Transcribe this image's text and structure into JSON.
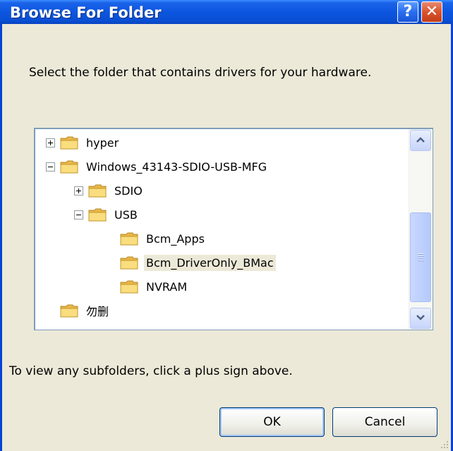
{
  "window": {
    "title": "Browse For Folder",
    "help_glyph": "?",
    "close_glyph": "✕"
  },
  "instructions": "Select the folder that contains drivers for your hardware.",
  "tree": {
    "items": [
      {
        "label": "hyper",
        "expander": "plus",
        "selected": false
      },
      {
        "label": "Windows_43143-SDIO-USB-MFG",
        "expander": "minus",
        "selected": false
      },
      {
        "label": "SDIO",
        "expander": "plus",
        "selected": false
      },
      {
        "label": "USB",
        "expander": "minus",
        "selected": false
      },
      {
        "label": "Bcm_Apps",
        "expander": "none",
        "selected": false
      },
      {
        "label": "Bcm_DriverOnly_BMac",
        "expander": "none",
        "selected": true
      },
      {
        "label": "NVRAM",
        "expander": "none",
        "selected": false
      },
      {
        "label": "勿删",
        "expander": "none",
        "selected": false
      }
    ]
  },
  "hint": "To view any subfolders, click a plus sign above.",
  "buttons": {
    "ok": "OK",
    "cancel": "Cancel"
  },
  "colors": {
    "titlebar": "#0a4fd4",
    "selection": "#ece9d8",
    "folder": "#f5d36b"
  }
}
